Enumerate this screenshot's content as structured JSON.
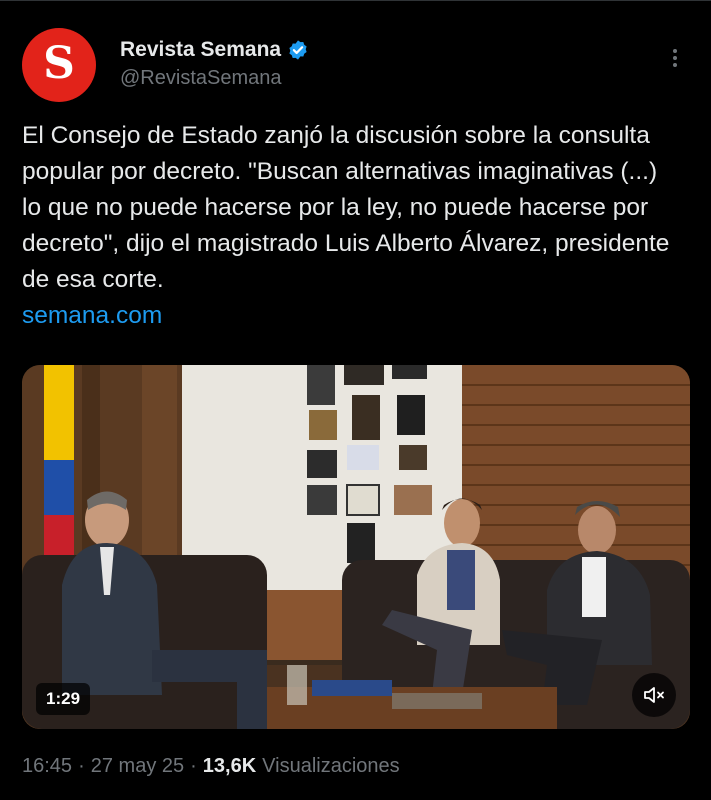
{
  "account": {
    "display_name": "Revista Semana",
    "handle": "@RevistaSemana",
    "avatar_letter": "S",
    "avatar_color": "#e2231a",
    "verified": true
  },
  "tweet": {
    "text": "El Consejo de Estado zanjó la discusión sobre la consulta popular por decreto. \"Buscan alternativas imaginativas (...) lo que no puede hacerse por la ley, no puede hacerse por decreto\", dijo el magistrado Luis Alberto Álvarez, presidente de esa corte.",
    "link": "semana.com"
  },
  "media": {
    "type": "video",
    "duration": "1:29",
    "mute_icon": "speaker-muted-icon"
  },
  "meta": {
    "time": "16:45",
    "date": "27 may 25",
    "views_count": "13,6K",
    "views_label": "Visualizaciones",
    "separator": "·"
  },
  "colors": {
    "background": "#000000",
    "text": "#e7e9ea",
    "secondary": "#71767b",
    "link": "#1d9bf0"
  }
}
